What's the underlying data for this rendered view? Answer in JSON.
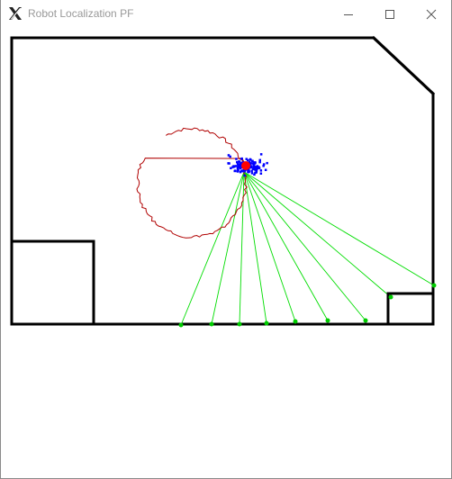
{
  "window": {
    "title": "Robot Localization PF",
    "app_icon": "x11-icon",
    "controls": [
      "minimize-icon",
      "maximize-icon",
      "close-icon"
    ]
  },
  "colors": {
    "walls": "#000000",
    "particles": "#0000ff",
    "robot": "#ff0000",
    "trajectory": "#b00000",
    "laser_rays": "#00dd00",
    "laser_hits": "#00cc00"
  }
}
